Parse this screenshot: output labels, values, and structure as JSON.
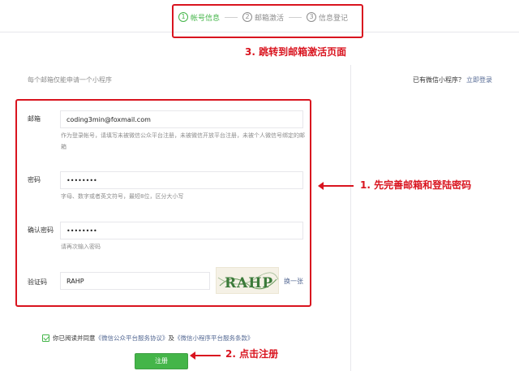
{
  "steps": [
    {
      "num": "1",
      "label": "帐号信息"
    },
    {
      "num": "2",
      "label": "邮箱激活"
    },
    {
      "num": "3",
      "label": "信息登记"
    }
  ],
  "hint": "每个邮箱仅能申请一个小程序",
  "has_account": {
    "text": "已有微信小程序？",
    "link": "立即登录"
  },
  "form": {
    "email": {
      "label": "邮箱",
      "value": "coding3min@foxmail.com",
      "tip": "作为登录帐号，请填写未被微信公众平台注册，未被微信开放平台注册，未被个人微信号绑定的邮箱"
    },
    "password": {
      "label": "密码",
      "value": "••••••••",
      "tip": "字母、数字或者英文符号，最短8位，区分大小写"
    },
    "confirm": {
      "label": "确认密码",
      "value": "••••••••",
      "tip": "请再次输入密码"
    },
    "captcha": {
      "label": "验证码",
      "value": "RAHP",
      "image_text": "RAHP",
      "refresh": "换一张"
    }
  },
  "agree": {
    "prefix": "你已阅读并同意",
    "link1": "《微信公众平台服务协议》",
    "middle": "及",
    "link2": "《微信小程序平台服务条款》"
  },
  "register_label": "注册",
  "annotations": {
    "a3": "3. 跳转到邮箱激活页面",
    "a1": "1. 先完善邮箱和登陆密码",
    "a2": "2. 点击注册"
  },
  "colors": {
    "accent_green": "#44b549",
    "annotation_red": "#d9141f",
    "link_blue": "#576b95"
  }
}
